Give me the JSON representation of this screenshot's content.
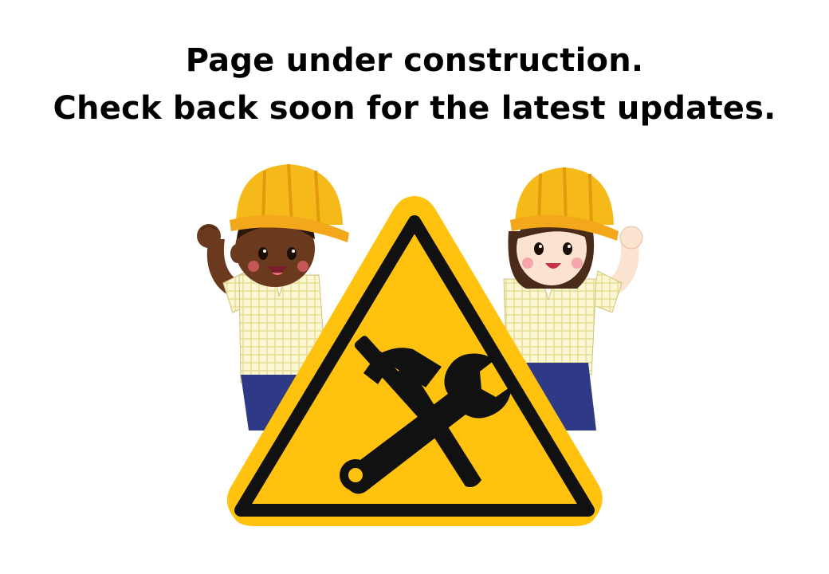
{
  "message": {
    "line1": "Page under construction.",
    "line2": "Check back soon for the latest updates."
  },
  "illustration": {
    "sign_icon": "hammer-and-wrench-icon",
    "colors": {
      "sign_yellow": "#FFC20E",
      "sign_border": "#111111",
      "helmet": "#F6B91A",
      "shirt_check": "#F8F3C4",
      "shorts": "#2E3A86",
      "skin_boy": "#6B3A1E",
      "skin_girl": "#FCE3CF"
    }
  }
}
